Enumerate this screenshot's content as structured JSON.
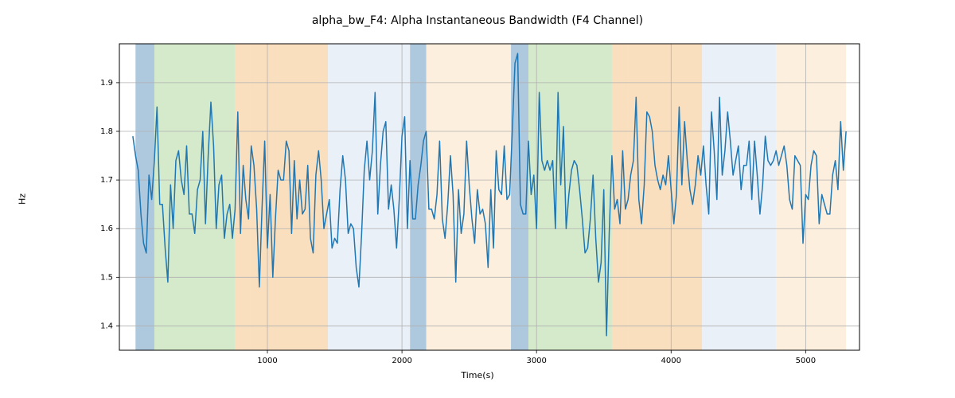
{
  "chart_data": {
    "type": "line",
    "title": "alpha_bw_F4: Alpha Instantaneous Bandwidth (F4 Channel)",
    "xlabel": "Time(s)",
    "ylabel": "Hz",
    "xlim": [
      -100,
      5400
    ],
    "ylim": [
      1.35,
      1.98
    ],
    "xticks": [
      1000,
      2000,
      3000,
      4000,
      5000
    ],
    "yticks": [
      1.4,
      1.5,
      1.6,
      1.7,
      1.8,
      1.9
    ],
    "segment_colors": {
      "blue": "#6b9bc3",
      "green": "#b0d9a0",
      "orange_dark": "#f5c48a",
      "lightblue": "#d8e4f0",
      "orange_light": "#fce2c3"
    },
    "segments": [
      {
        "start": 20,
        "end": 160,
        "color": "blue"
      },
      {
        "start": 160,
        "end": 760,
        "color": "green"
      },
      {
        "start": 760,
        "end": 870,
        "color": "orange_dark"
      },
      {
        "start": 870,
        "end": 1450,
        "color": "orange_dark"
      },
      {
        "start": 1450,
        "end": 2060,
        "color": "lightblue"
      },
      {
        "start": 2060,
        "end": 2180,
        "color": "blue"
      },
      {
        "start": 2180,
        "end": 2810,
        "color": "orange_light"
      },
      {
        "start": 2810,
        "end": 2940,
        "color": "blue"
      },
      {
        "start": 2940,
        "end": 3560,
        "color": "green"
      },
      {
        "start": 3560,
        "end": 3680,
        "color": "orange_dark"
      },
      {
        "start": 3680,
        "end": 4230,
        "color": "orange_dark"
      },
      {
        "start": 4230,
        "end": 4780,
        "color": "lightblue"
      },
      {
        "start": 4780,
        "end": 4860,
        "color": "orange_light"
      },
      {
        "start": 4860,
        "end": 5300,
        "color": "orange_light"
      }
    ],
    "x": [
      0,
      20,
      40,
      60,
      80,
      100,
      120,
      140,
      160,
      180,
      200,
      220,
      240,
      260,
      280,
      300,
      320,
      340,
      360,
      380,
      400,
      420,
      440,
      460,
      480,
      500,
      520,
      540,
      560,
      580,
      600,
      620,
      640,
      660,
      680,
      700,
      720,
      740,
      760,
      780,
      800,
      820,
      840,
      860,
      880,
      900,
      920,
      940,
      960,
      980,
      1000,
      1020,
      1040,
      1060,
      1080,
      1100,
      1120,
      1140,
      1160,
      1180,
      1200,
      1220,
      1240,
      1260,
      1280,
      1300,
      1320,
      1340,
      1360,
      1380,
      1400,
      1420,
      1440,
      1460,
      1480,
      1500,
      1520,
      1540,
      1560,
      1580,
      1600,
      1620,
      1640,
      1660,
      1680,
      1700,
      1720,
      1740,
      1760,
      1780,
      1800,
      1820,
      1840,
      1860,
      1880,
      1900,
      1920,
      1940,
      1960,
      1980,
      2000,
      2020,
      2040,
      2060,
      2080,
      2100,
      2120,
      2140,
      2160,
      2180,
      2200,
      2220,
      2240,
      2260,
      2280,
      2300,
      2320,
      2340,
      2360,
      2380,
      2400,
      2420,
      2440,
      2460,
      2480,
      2500,
      2520,
      2540,
      2560,
      2580,
      2600,
      2620,
      2640,
      2660,
      2680,
      2700,
      2720,
      2740,
      2760,
      2780,
      2800,
      2820,
      2840,
      2860,
      2880,
      2900,
      2920,
      2940,
      2960,
      2980,
      3000,
      3020,
      3040,
      3060,
      3080,
      3100,
      3120,
      3140,
      3160,
      3180,
      3200,
      3220,
      3240,
      3260,
      3280,
      3300,
      3320,
      3340,
      3360,
      3380,
      3400,
      3420,
      3440,
      3460,
      3480,
      3500,
      3520,
      3540,
      3560,
      3580,
      3600,
      3620,
      3640,
      3660,
      3680,
      3700,
      3720,
      3740,
      3760,
      3780,
      3800,
      3820,
      3840,
      3860,
      3880,
      3900,
      3920,
      3940,
      3960,
      3980,
      4000,
      4020,
      4040,
      4060,
      4080,
      4100,
      4120,
      4140,
      4160,
      4180,
      4200,
      4220,
      4240,
      4260,
      4280,
      4300,
      4320,
      4340,
      4360,
      4380,
      4400,
      4420,
      4440,
      4460,
      4480,
      4500,
      4520,
      4540,
      4560,
      4580,
      4600,
      4620,
      4640,
      4660,
      4680,
      4700,
      4720,
      4740,
      4760,
      4780,
      4800,
      4820,
      4840,
      4860,
      4880,
      4900,
      4920,
      4940,
      4960,
      4980,
      5000,
      5020,
      5040,
      5060,
      5080,
      5100,
      5120,
      5140,
      5160,
      5180,
      5200,
      5220,
      5240,
      5260,
      5280,
      5300
    ],
    "values": [
      1.79,
      1.75,
      1.72,
      1.63,
      1.57,
      1.55,
      1.71,
      1.66,
      1.74,
      1.85,
      1.65,
      1.65,
      1.56,
      1.49,
      1.69,
      1.6,
      1.74,
      1.76,
      1.7,
      1.67,
      1.77,
      1.63,
      1.63,
      1.59,
      1.68,
      1.7,
      1.8,
      1.61,
      1.75,
      1.86,
      1.77,
      1.6,
      1.69,
      1.71,
      1.58,
      1.63,
      1.65,
      1.58,
      1.64,
      1.84,
      1.59,
      1.73,
      1.66,
      1.62,
      1.77,
      1.73,
      1.64,
      1.48,
      1.64,
      1.78,
      1.56,
      1.67,
      1.5,
      1.62,
      1.72,
      1.7,
      1.7,
      1.78,
      1.76,
      1.59,
      1.74,
      1.62,
      1.7,
      1.63,
      1.64,
      1.73,
      1.58,
      1.55,
      1.71,
      1.76,
      1.7,
      1.6,
      1.63,
      1.66,
      1.56,
      1.58,
      1.57,
      1.68,
      1.75,
      1.7,
      1.59,
      1.61,
      1.6,
      1.52,
      1.48,
      1.59,
      1.72,
      1.78,
      1.7,
      1.76,
      1.88,
      1.63,
      1.73,
      1.8,
      1.82,
      1.64,
      1.69,
      1.64,
      1.56,
      1.66,
      1.79,
      1.83,
      1.6,
      1.74,
      1.62,
      1.62,
      1.69,
      1.73,
      1.78,
      1.8,
      1.64,
      1.64,
      1.62,
      1.67,
      1.78,
      1.62,
      1.58,
      1.65,
      1.75,
      1.67,
      1.49,
      1.68,
      1.59,
      1.63,
      1.78,
      1.69,
      1.62,
      1.57,
      1.68,
      1.63,
      1.64,
      1.61,
      1.52,
      1.68,
      1.56,
      1.76,
      1.68,
      1.67,
      1.77,
      1.66,
      1.67,
      1.8,
      1.94,
      1.96,
      1.65,
      1.63,
      1.63,
      1.78,
      1.67,
      1.71,
      1.6,
      1.88,
      1.74,
      1.72,
      1.74,
      1.72,
      1.74,
      1.6,
      1.88,
      1.69,
      1.81,
      1.6,
      1.67,
      1.72,
      1.74,
      1.73,
      1.68,
      1.62,
      1.55,
      1.56,
      1.62,
      1.71,
      1.58,
      1.49,
      1.53,
      1.68,
      1.38,
      1.59,
      1.75,
      1.64,
      1.66,
      1.61,
      1.76,
      1.64,
      1.66,
      1.71,
      1.74,
      1.87,
      1.66,
      1.61,
      1.69,
      1.84,
      1.83,
      1.8,
      1.73,
      1.7,
      1.68,
      1.71,
      1.69,
      1.75,
      1.68,
      1.61,
      1.67,
      1.85,
      1.69,
      1.82,
      1.74,
      1.68,
      1.65,
      1.69,
      1.75,
      1.71,
      1.77,
      1.69,
      1.63,
      1.84,
      1.76,
      1.66,
      1.87,
      1.71,
      1.76,
      1.84,
      1.78,
      1.71,
      1.74,
      1.77,
      1.68,
      1.73,
      1.73,
      1.78,
      1.66,
      1.78,
      1.71,
      1.63,
      1.69,
      1.79,
      1.74,
      1.73,
      1.74,
      1.76,
      1.73,
      1.75,
      1.77,
      1.73,
      1.66,
      1.64,
      1.75,
      1.74,
      1.73,
      1.57,
      1.67,
      1.66,
      1.73,
      1.76,
      1.75,
      1.61,
      1.67,
      1.65,
      1.63,
      1.63,
      1.71,
      1.74,
      1.68,
      1.82,
      1.72,
      1.8
    ]
  }
}
